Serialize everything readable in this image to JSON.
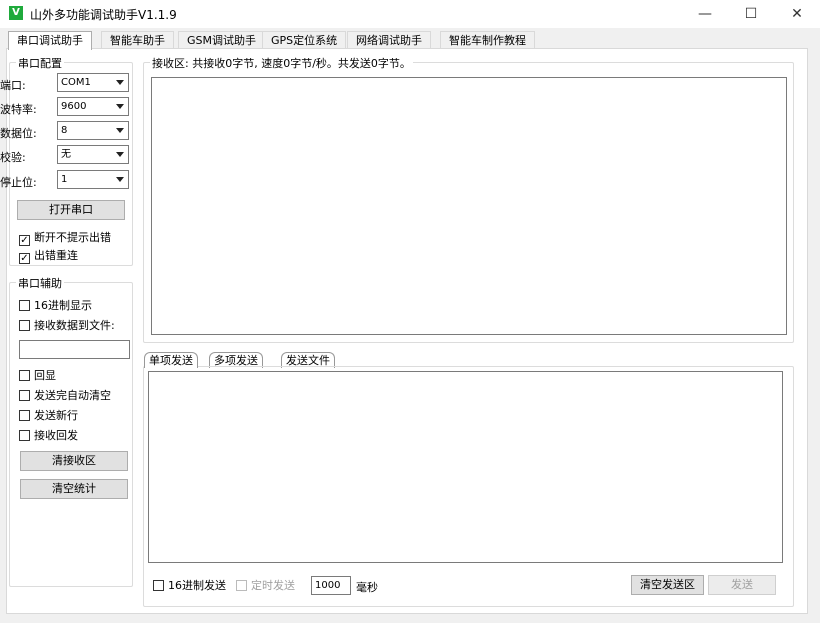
{
  "window": {
    "title": "山外多功能调试助手V1.1.9",
    "app_icon": "V",
    "minimize": "—",
    "maximize": "☐",
    "close": "✕"
  },
  "tabs": [
    "串口调试助手",
    "智能车助手",
    "GSM调试助手",
    "GPS定位系统",
    "网络调试助手",
    "智能车制作教程"
  ],
  "serial_config": {
    "title": "串口配置",
    "port_label": "端口:",
    "port_value": "COM1",
    "baud_label": "波特率:",
    "baud_value": "9600",
    "databits_label": "数据位:",
    "databits_value": "8",
    "parity_label": "校验:",
    "parity_value": "无",
    "stopbits_label": "停止位:",
    "stopbits_value": "1",
    "open_button": "打开串口",
    "no_error_prompt": "断开不提示出错",
    "no_error_prompt_checked": true,
    "reconnect": "出错重连",
    "reconnect_checked": true
  },
  "serial_assist": {
    "title": "串口辅助",
    "hex_display": "16进制显示",
    "hex_display_checked": false,
    "recv_to_file": "接收数据到文件:",
    "recv_to_file_checked": false,
    "file_path": "",
    "echo": "回显",
    "echo_checked": false,
    "auto_clear": "发送完自动清空",
    "auto_clear_checked": false,
    "send_newline": "发送新行",
    "send_newline_checked": false,
    "recv_reply": "接收回发",
    "recv_reply_checked": false,
    "clear_recv_button": "清接收区",
    "clear_stats_button": "清空统计"
  },
  "receive": {
    "status": "接收区: 共接收0字节, 速度0字节/秒。共发送0字节。",
    "content": ""
  },
  "send": {
    "subtabs": [
      "单项发送",
      "多项发送",
      "发送文件"
    ],
    "content": "",
    "hex_send": "16进制发送",
    "hex_send_checked": false,
    "timed_send": "定时发送",
    "timed_send_checked": false,
    "interval_value": "1000",
    "interval_unit": "毫秒",
    "clear_send_button": "清空发送区",
    "send_button": "发送"
  },
  "colors": {
    "accent_icon": "#1faa3c",
    "window_bg": "#f0f0f0"
  }
}
